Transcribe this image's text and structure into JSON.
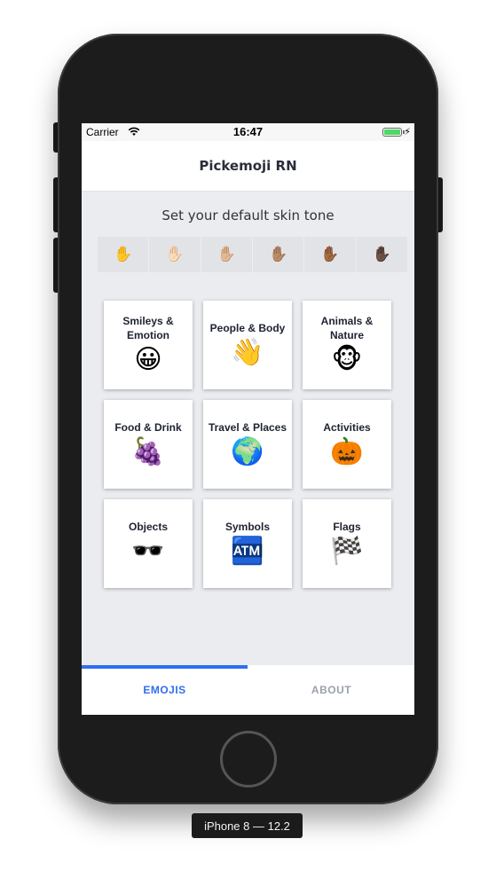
{
  "device_label": "iPhone 8 — 12.2",
  "status_bar": {
    "carrier": "Carrier",
    "time": "16:47",
    "battery_color": "#4cd964"
  },
  "nav": {
    "title": "Pickemoji RN"
  },
  "skin_tone": {
    "prompt": "Set your default skin tone",
    "options": [
      "✋",
      "✋🏻",
      "✋🏼",
      "✋🏽",
      "✋🏾",
      "✋🏿"
    ]
  },
  "categories": [
    {
      "label": "Smileys & Emotion",
      "emoji": "😀"
    },
    {
      "label": "People & Body",
      "emoji": "👋"
    },
    {
      "label": "Animals & Nature",
      "emoji": "🐵"
    },
    {
      "label": "Food & Drink",
      "emoji": "🍇"
    },
    {
      "label": "Travel & Places",
      "emoji": "🌍"
    },
    {
      "label": "Activities",
      "emoji": "🎃"
    },
    {
      "label": "Objects",
      "emoji": "🕶️"
    },
    {
      "label": "Symbols",
      "emoji": "🏧"
    },
    {
      "label": "Flags",
      "emoji": "🏁"
    }
  ],
  "tabs": [
    {
      "label": "EMOJIS",
      "active": true
    },
    {
      "label": "ABOUT",
      "active": false
    }
  ],
  "colors": {
    "accent": "#2f6ef0",
    "inactive_tab": "#9aa0ad",
    "screen_bg": "#ebecf0"
  }
}
